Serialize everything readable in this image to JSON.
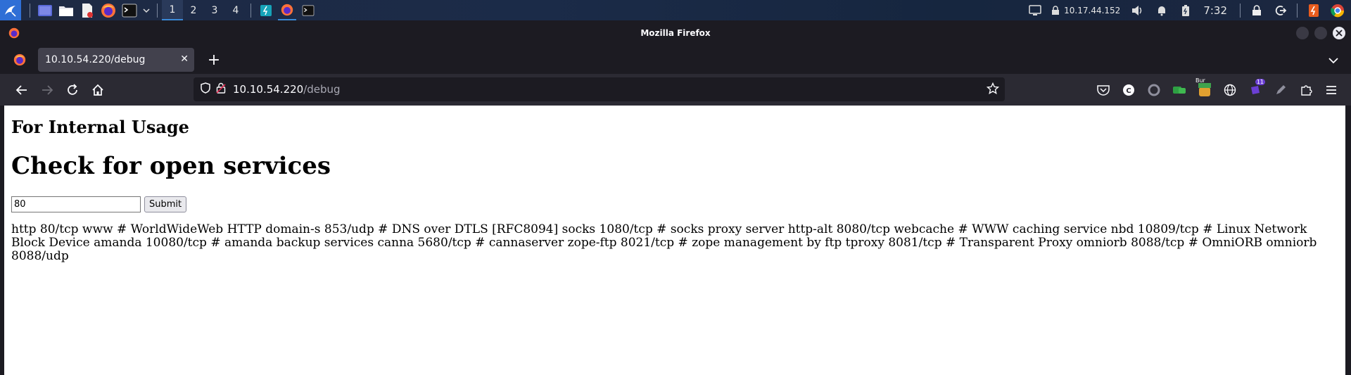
{
  "taskbar": {
    "workspaces": [
      "1",
      "2",
      "3",
      "4"
    ],
    "active_workspace": "1",
    "ip_address": "10.17.44.152",
    "clock": "7:32",
    "ext_badge": "Bur",
    "ext_count": "11"
  },
  "window": {
    "title": "Mozilla Firefox"
  },
  "tab": {
    "title": "10.10.54.220/debug",
    "close_label": "✕",
    "new_tab_label": "+"
  },
  "urlbar": {
    "host": "10.10.54.220",
    "path": "/debug"
  },
  "page": {
    "subheading": "For Internal Usage",
    "heading": "Check for open services",
    "port_input_value": "80",
    "submit_label": "Submit",
    "result": "http 80/tcp www # WorldWideWeb HTTP domain-s 853/udp # DNS over DTLS [RFC8094] socks 1080/tcp # socks proxy server http-alt 8080/tcp webcache # WWW caching service nbd 10809/tcp # Linux Network Block Device amanda 10080/tcp # amanda backup services canna 5680/tcp # cannaserver zope-ftp 8021/tcp # zope management by ftp tproxy 8081/tcp # Transparent Proxy omniorb 8088/tcp # OmniORB omniorb 8088/udp"
  },
  "icons": {
    "kali_menu": "kali-dragon-icon",
    "workspace_switcher": "workspace-icon",
    "file_manager": "folder-icon",
    "text_editor": "text-editor-icon",
    "firefox": "firefox-icon",
    "terminal": "terminal-icon",
    "back": "back-arrow-icon",
    "forward": "forward-arrow-icon",
    "reload": "reload-icon",
    "home": "home-icon",
    "shield": "shield-icon",
    "lock": "lock-icon",
    "star": "star-icon"
  },
  "colors": {
    "chrome_dark": "#1c1b22",
    "toolbar": "#2b2a33",
    "tab_active": "#42414d",
    "accent": "#3a8ad8"
  }
}
